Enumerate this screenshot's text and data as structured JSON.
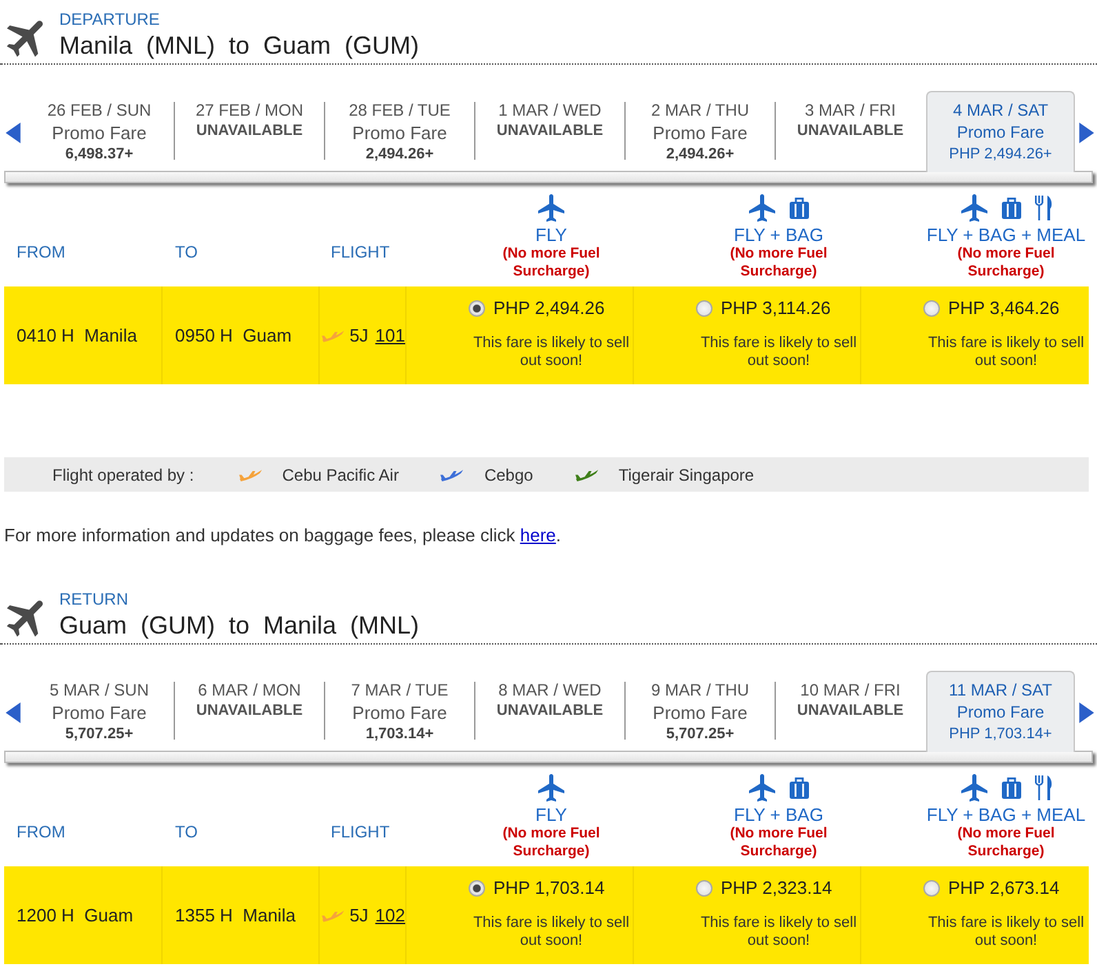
{
  "departure": {
    "label": "DEPARTURE",
    "route": "Manila (MNL) to Guam (GUM)",
    "dates": [
      {
        "kind": "fare",
        "date": "26 FEB / SUN",
        "fare_type": "Promo Fare",
        "price": "6,498.37+",
        "selected": false
      },
      {
        "kind": "unavailable",
        "date": "27 FEB / MON",
        "status": "UNAVAILABLE",
        "selected": false
      },
      {
        "kind": "fare",
        "date": "28 FEB / TUE",
        "fare_type": "Promo Fare",
        "price": "2,494.26+",
        "selected": false
      },
      {
        "kind": "unavailable",
        "date": "1 MAR / WED",
        "status": "UNAVAILABLE",
        "selected": false
      },
      {
        "kind": "fare",
        "date": "2 MAR / THU",
        "fare_type": "Promo Fare",
        "price": "2,494.26+",
        "selected": false
      },
      {
        "kind": "unavailable",
        "date": "3 MAR / FRI",
        "status": "UNAVAILABLE",
        "selected": false
      },
      {
        "kind": "fare",
        "date": "4 MAR / SAT",
        "fare_type": "Promo Fare",
        "price": "PHP 2,494.26+",
        "selected": true
      }
    ],
    "columns": [
      "FROM",
      "TO",
      "FLIGHT"
    ],
    "fare_columns": [
      {
        "kind": "fly",
        "label": "FLY",
        "note": "(No more Fuel Surcharge)"
      },
      {
        "kind": "fly_bag",
        "label": "FLY + BAG",
        "note": "(No more Fuel Surcharge)"
      },
      {
        "kind": "fly_bag_meal",
        "label": "FLY + BAG + MEAL",
        "note": "(No more Fuel Surcharge)"
      }
    ],
    "flights": [
      {
        "from": "0410 H  Manila",
        "to": "0950 H  Guam",
        "carrier": "5J",
        "number": "101",
        "color": "#f5a33c",
        "fares": [
          {
            "price": "PHP 2,494.26",
            "selected": true,
            "note": "This fare is likely to sell out soon!"
          },
          {
            "price": "PHP 3,114.26",
            "selected": false,
            "note": "This fare is likely to sell out soon!"
          },
          {
            "price": "PHP 3,464.26",
            "selected": false,
            "note": "This fare is likely to sell out soon!"
          }
        ]
      }
    ]
  },
  "operated_by": {
    "label": "Flight operated by :",
    "items": [
      {
        "name": "Cebu Pacific Air",
        "color": "#f5a33c"
      },
      {
        "name": "Cebgo",
        "color": "#3d6fd8"
      },
      {
        "name": "Tigerair Singapore",
        "color": "#3f7f1a"
      }
    ]
  },
  "baggage_info": {
    "text": "For more information and updates on baggage fees, please click",
    "link": "here",
    "after": "."
  },
  "return": {
    "label": "RETURN",
    "route": "Guam (GUM) to Manila (MNL)",
    "dates": [
      {
        "kind": "fare",
        "date": "5 MAR / SUN",
        "fare_type": "Promo Fare",
        "price": "5,707.25+",
        "selected": false
      },
      {
        "kind": "unavailable",
        "date": "6 MAR / MON",
        "status": "UNAVAILABLE",
        "selected": false
      },
      {
        "kind": "fare",
        "date": "7 MAR / TUE",
        "fare_type": "Promo Fare",
        "price": "1,703.14+",
        "selected": false
      },
      {
        "kind": "unavailable",
        "date": "8 MAR / WED",
        "status": "UNAVAILABLE",
        "selected": false
      },
      {
        "kind": "fare",
        "date": "9 MAR / THU",
        "fare_type": "Promo Fare",
        "price": "5,707.25+",
        "selected": false
      },
      {
        "kind": "unavailable",
        "date": "10 MAR / FRI",
        "status": "UNAVAILABLE",
        "selected": false
      },
      {
        "kind": "fare",
        "date": "11 MAR / SAT",
        "fare_type": "Promo Fare",
        "price": "PHP 1,703.14+",
        "selected": true
      }
    ],
    "columns": [
      "FROM",
      "TO",
      "FLIGHT"
    ],
    "fare_columns": [
      {
        "kind": "fly",
        "label": "FLY",
        "note": "(No more Fuel Surcharge)"
      },
      {
        "kind": "fly_bag",
        "label": "FLY + BAG",
        "note": "(No more Fuel Surcharge)"
      },
      {
        "kind": "fly_bag_meal",
        "label": "FLY + BAG + MEAL",
        "note": "(No more Fuel Surcharge)"
      }
    ],
    "flights": [
      {
        "from": "1200 H  Guam",
        "to": "1355 H  Manila",
        "carrier": "5J",
        "number": "102",
        "color": "#f5a33c",
        "fares": [
          {
            "price": "PHP 1,703.14",
            "selected": true,
            "note": "This fare is likely to sell out soon!"
          },
          {
            "price": "PHP 2,323.14",
            "selected": false,
            "note": "This fare is likely to sell out soon!"
          },
          {
            "price": "PHP 2,673.14",
            "selected": false,
            "note": "This fare is likely to sell out soon!"
          }
        ]
      }
    ]
  }
}
